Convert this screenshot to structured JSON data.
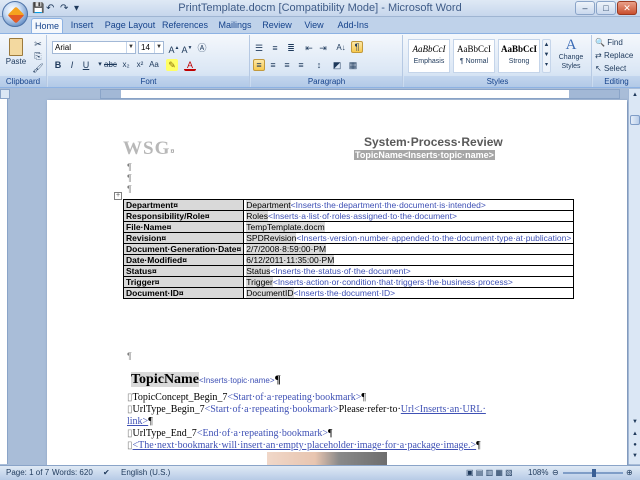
{
  "window": {
    "title": "PrintTemplate.docm [Compatibility Mode] - Microsoft Word",
    "quick_access": [
      "💾",
      "↶",
      "↷",
      "▾"
    ]
  },
  "tabs": [
    "Home",
    "Insert",
    "Page Layout",
    "References",
    "Mailings",
    "Review",
    "View",
    "Add-Ins"
  ],
  "ribbon": {
    "clipboard": {
      "paste": "Paste",
      "label": "Clipboard"
    },
    "font": {
      "name": "Arial",
      "size": "14",
      "label": "Font"
    },
    "paragraph": {
      "label": "Paragraph"
    },
    "styles": {
      "label": "Styles",
      "cards": [
        {
          "preview": "AaBbCcI",
          "name": "Emphasis"
        },
        {
          "preview": "AaBbCcI",
          "name": "¶ Normal"
        },
        {
          "preview": "AaBbCcI",
          "name": "Strong"
        }
      ],
      "change_styles": "Change Styles"
    },
    "editing": {
      "find": "Find",
      "replace": "Replace",
      "select": "Select",
      "label": "Editing"
    }
  },
  "document": {
    "logo": "WSG",
    "logo_mark": "¤",
    "header_title": "System·Process·Review",
    "header_sub": "TopicName<Inserts·topic·name>",
    "para_marks": [
      "¶",
      "¶",
      "¶"
    ],
    "table": [
      {
        "label": "Department¤",
        "field": "Department",
        "placeholder": "<Inserts·the·department·the·document·is·intended>"
      },
      {
        "label": "Responsibility/Role¤",
        "field": "Roles",
        "placeholder": "<Inserts·a·list·of·roles·assigned·to·the·document>"
      },
      {
        "label": "File·Name¤",
        "field": "TempTemplate.docm",
        "placeholder": ""
      },
      {
        "label": "Revision¤",
        "field": "SPDRevision",
        "placeholder": "<Inserts·version·number·appended·to·the·document·type·at·publication>"
      },
      {
        "label": "Document·Generation·Date¤",
        "field": "2/7/2008·8:59:00·PM",
        "placeholder": ""
      },
      {
        "label": "Date·Modified¤",
        "field": "6/12/2011·11:35:00·PM",
        "placeholder": ""
      },
      {
        "label": "Status¤",
        "field": "Status",
        "placeholder": "<Inserts·the·status·of·the·document>"
      },
      {
        "label": "Trigger¤",
        "field": "Trigger",
        "placeholder": "<Inserts·action·or·condition·that·triggers·the·business·process>"
      },
      {
        "label": "Document·ID¤",
        "field": "DocumentID",
        "placeholder": "<Inserts·the·document·ID>"
      }
    ],
    "topic_heading": "TopicName",
    "topic_placeholder": "<Inserts·topic·name>",
    "lines": [
      {
        "a": "TopicConcept_Begin_7",
        "b": "<Start·of·a·repeating·bookmark>",
        "c": "¶"
      },
      {
        "a": "UrlType_Begin_7",
        "b": "<Start·of·a·repeating·bookmark>",
        "c": "Please·refer·to·"
      },
      {
        "a": "link>",
        "b": "",
        "c": "¶"
      },
      {
        "a": "UrlType_End_7",
        "b": "<End·of·a·repeating·bookmark>",
        "c": "¶"
      },
      {
        "a": "",
        "b": "<The·next·bookmark·will·insert·an·empty·placeholder·image·for·a·package·image.>",
        "c": "¶"
      }
    ],
    "url_field": "Url<Inserts·an·URL·"
  },
  "status": {
    "page": "Page: 1 of 7",
    "words": "Words: 620",
    "language": "English (U.S.)",
    "zoom": "108%"
  }
}
